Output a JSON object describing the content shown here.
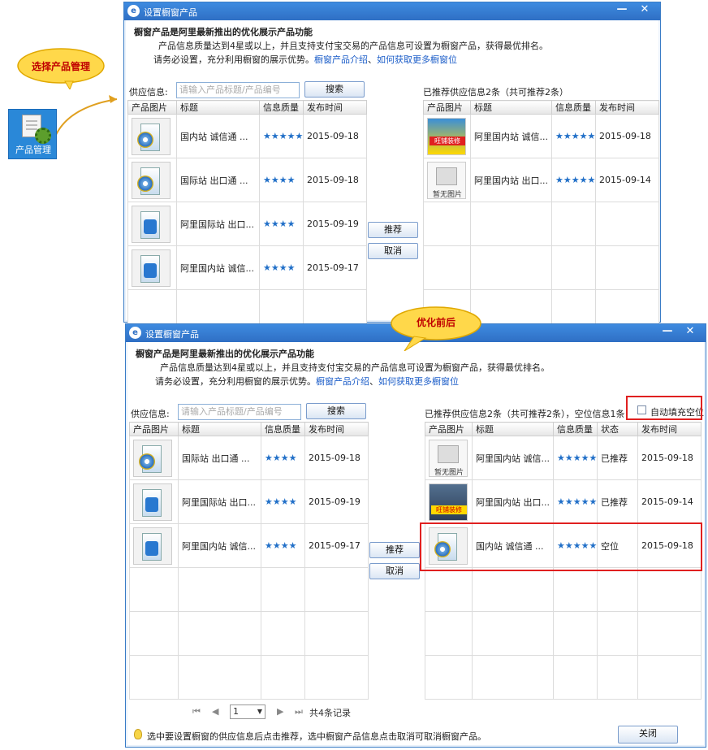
{
  "callout": {
    "text": "选择产品管理"
  },
  "sidebar_icon": {
    "label": "产品管理",
    "icon": "product-management-gear-icon"
  },
  "balloon": {
    "text": "优化前后"
  },
  "windows": [
    {
      "title": "设置橱窗产品",
      "controls": {
        "minimize": "—",
        "close": "✕"
      },
      "intro": {
        "heading": "橱窗产品是阿里最新推出的优化展示产品功能",
        "line1": "产品信息质量达到4星或以上，并且支持支付宝交易的产品信息可设置为橱窗产品，获得最优排名。",
        "line2": "请务必设置，充分利用橱窗的展示优势。",
        "link1": "橱窗产品介绍",
        "sep": "、",
        "link2": "如何获取更多橱窗位"
      },
      "supply_label": "供应信息:",
      "search_placeholder": "请输入产品标题/产品编号",
      "search_button": "搜索",
      "right_title": "已推荐供应信息2条（共可推荐2条）",
      "recommend_button": "推荐",
      "cancel_button": "取消",
      "left_columns": [
        "产品图片",
        "标题",
        "信息质量",
        "发布时间"
      ],
      "left_rows": [
        {
          "thumb": "disc",
          "title": "国内站 诚信通 ...",
          "stars": "★★★★★",
          "date": "2015-09-18"
        },
        {
          "thumb": "disc",
          "title": "国际站 出口通 ...",
          "stars": "★★★★",
          "date": "2015-09-18"
        },
        {
          "thumb": "blue",
          "title": "阿里国际站 出口...",
          "stars": "★★★★",
          "date": "2015-09-19"
        },
        {
          "thumb": "blue",
          "title": "阿里国内站 诚信...",
          "stars": "★★★★",
          "date": "2015-09-17"
        }
      ],
      "right_columns": [
        "产品图片",
        "标题",
        "信息质量",
        "发布时间"
      ],
      "right_rows": [
        {
          "thumb": "promo",
          "thumb_text": "旺铺装修",
          "title": "阿里国内站 诚信...",
          "stars": "★★★★★",
          "date": "2015-09-18"
        },
        {
          "thumb": "noimg",
          "thumb_text": "暂无图片",
          "title": "阿里国内站 出口...",
          "stars": "★★★★★",
          "date": "2015-09-14"
        }
      ]
    },
    {
      "title": "设置橱窗产品",
      "controls": {
        "minimize": "—",
        "close": "✕"
      },
      "intro": {
        "heading": "橱窗产品是阿里最新推出的优化展示产品功能",
        "line1": "产品信息质量达到4星或以上，并且支持支付宝交易的产品信息可设置为橱窗产品，获得最优排名。",
        "line2": "请务必设置，充分利用橱窗的展示优势。",
        "link1": "橱窗产品介绍",
        "sep": "、",
        "link2": "如何获取更多橱窗位"
      },
      "supply_label": "供应信息:",
      "search_placeholder": "请输入产品标题/产品编号",
      "search_button": "搜索",
      "right_title": "已推荐供应信息2条（共可推荐2条），空位信息1条",
      "auto_fill_label": "自动填充空位",
      "recommend_button": "推荐",
      "cancel_button": "取消",
      "left_columns": [
        "产品图片",
        "标题",
        "信息质量",
        "发布时间"
      ],
      "left_rows": [
        {
          "thumb": "disc",
          "title": "国际站 出口通 ...",
          "stars": "★★★★",
          "date": "2015-09-18"
        },
        {
          "thumb": "blue",
          "title": "阿里国际站 出口...",
          "stars": "★★★★",
          "date": "2015-09-19"
        },
        {
          "thumb": "blue",
          "title": "阿里国内站 诚信...",
          "stars": "★★★★",
          "date": "2015-09-17"
        }
      ],
      "right_columns": [
        "产品图片",
        "标题",
        "信息质量",
        "状态",
        "发布时间"
      ],
      "right_rows": [
        {
          "thumb": "noimg",
          "thumb_text": "暂无图片",
          "title": "阿里国内站 诚信...",
          "stars": "★★★★★",
          "status": "已推荐",
          "date": "2015-09-18"
        },
        {
          "thumb": "dark",
          "thumb_text": "旺铺装修",
          "title": "阿里国内站 出口...",
          "stars": "★★★★★",
          "status": "已推荐",
          "date": "2015-09-14"
        },
        {
          "thumb": "disc",
          "thumb_text": "",
          "title": "国内站 诚信通 ...",
          "stars": "★★★★★",
          "status": "空位",
          "date": "2015-09-18"
        }
      ],
      "pager": {
        "first": "⏮",
        "prev": "◀",
        "page": "1",
        "next": "▶",
        "last": "⏭",
        "total": "共4条记录"
      },
      "footer_tip": "选中要设置橱窗的供应信息后点击推荐，选中橱窗产品信息点击取消可取消橱窗产品。",
      "close_button": "关闭"
    }
  ]
}
